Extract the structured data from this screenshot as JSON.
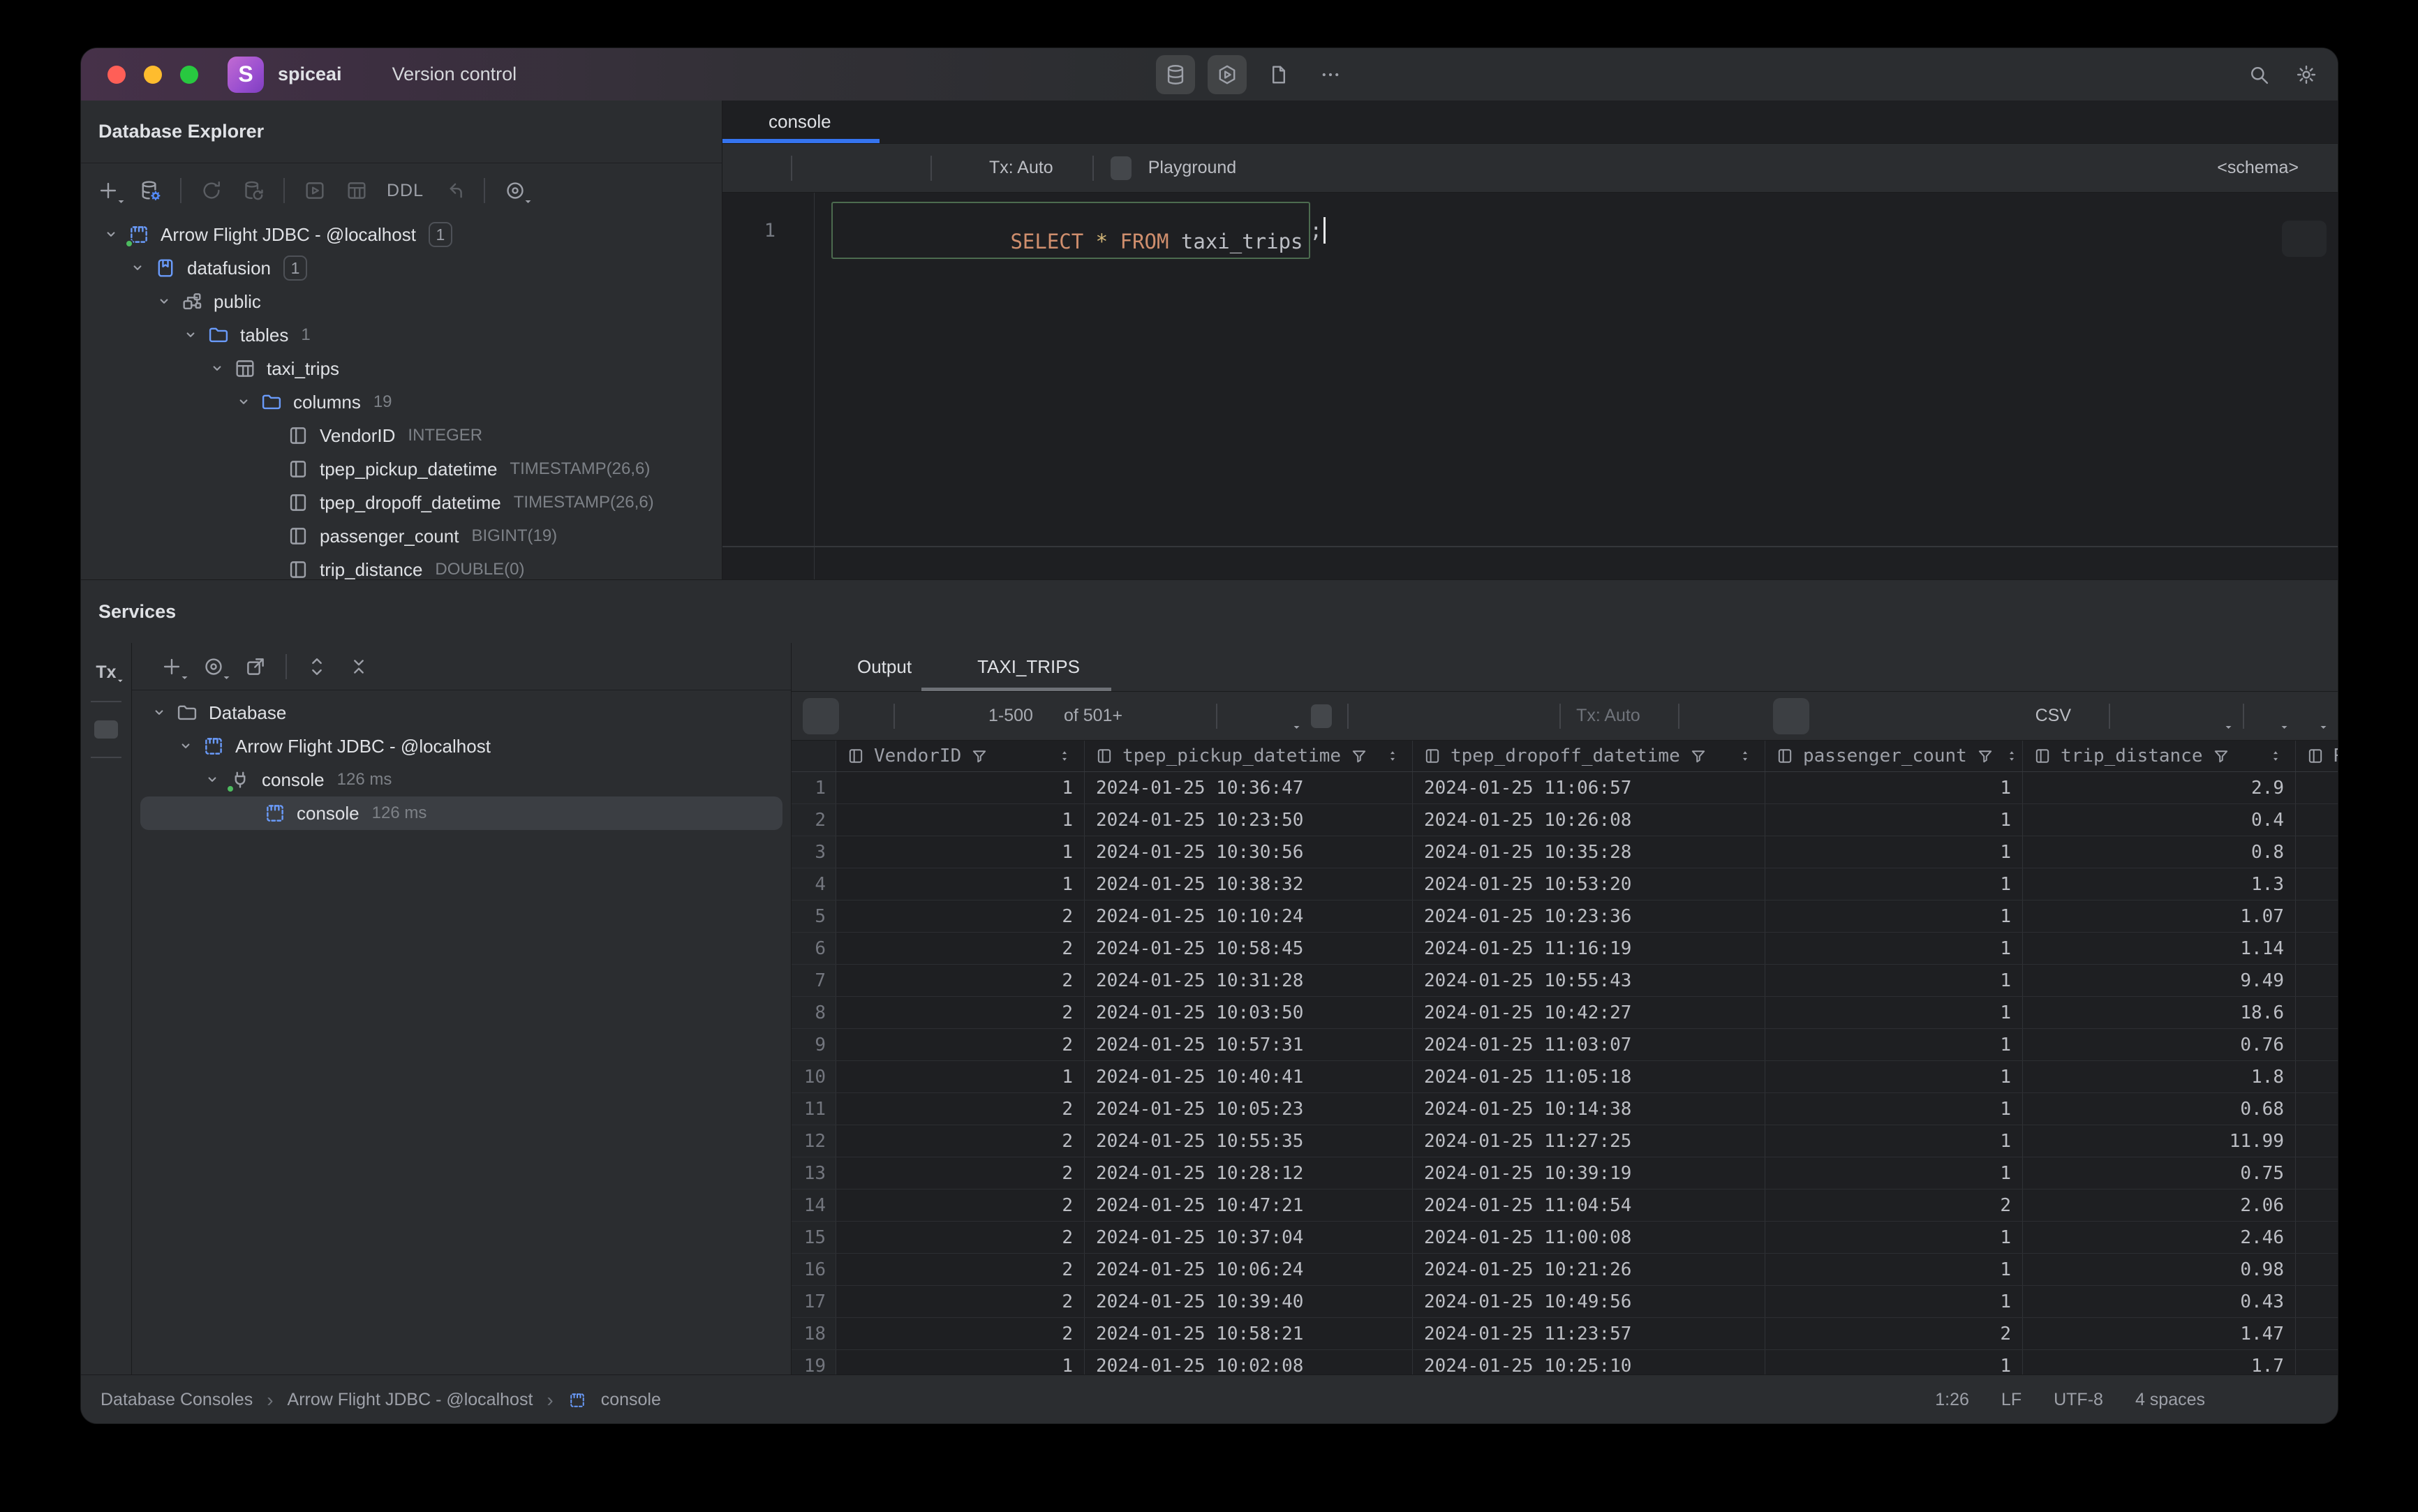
{
  "titlebar": {
    "app_name": "spiceai",
    "menu_version": "Version control",
    "window_buttons": [
      "close",
      "minimize",
      "zoom"
    ],
    "center_icons": [
      {
        "icon": "db",
        "name": "database-tool-icon",
        "active": true
      },
      {
        "icon": "hexplay",
        "name": "run-tool-icon",
        "active": true
      },
      {
        "icon": "file",
        "name": "project-files-icon",
        "active": false
      },
      {
        "icon": "moreh",
        "name": "more-icon",
        "active": false
      }
    ],
    "right_icons": [
      {
        "icon": "search",
        "name": "search-icon"
      },
      {
        "icon": "gear",
        "name": "settings-icon"
      }
    ]
  },
  "database_explorer": {
    "title": "Database Explorer",
    "toolbar": [
      {
        "icon": "plus",
        "name": "add-datasource-icon",
        "dd": true
      },
      {
        "icon": "dbgear",
        "name": "datasource-properties-icon"
      },
      {
        "sep": true
      },
      {
        "icon": "refresh",
        "name": "refresh-icon",
        "disabled": true
      },
      {
        "icon": "dbrefresh",
        "name": "sync-datasource-icon",
        "disabled": true
      },
      {
        "sep": true
      },
      {
        "icon": "playbox",
        "name": "query-console-icon",
        "disabled": true
      },
      {
        "icon": "tablegrid",
        "name": "open-table-icon",
        "disabled": true
      },
      {
        "label": "DDL",
        "name": "ddl-button",
        "disabled": true
      },
      {
        "icon": "jump",
        "name": "navigate-back-icon",
        "disabled": true
      },
      {
        "sep": true
      },
      {
        "icon": "eyetarget",
        "name": "view-options-icon",
        "dd": true
      }
    ],
    "tree": [
      {
        "level": 0,
        "chevron": "down",
        "icon": "dstable",
        "icon_color": "blue",
        "green_dot": true,
        "label": "Arrow Flight JDBC - @localhost",
        "badge": "1"
      },
      {
        "level": 1,
        "chevron": "down",
        "icon": "dbblue",
        "icon_color": "blue",
        "label": "datafusion",
        "badge": "1"
      },
      {
        "level": 2,
        "chevron": "down",
        "icon": "schema",
        "label": "public"
      },
      {
        "level": 3,
        "chevron": "down",
        "icon": "folder",
        "icon_color": "blue",
        "label": "tables",
        "count": "1"
      },
      {
        "level": 4,
        "chevron": "down",
        "icon": "tablegrid",
        "label": "taxi_trips"
      },
      {
        "level": 5,
        "chevron": "down",
        "icon": "folder",
        "icon_color": "blue",
        "label": "columns",
        "count": "19"
      },
      {
        "level": 6,
        "icon": "column",
        "label": "VendorID",
        "type": "INTEGER"
      },
      {
        "level": 6,
        "icon": "column",
        "label": "tpep_pickup_datetime",
        "type": "TIMESTAMP(26,6)"
      },
      {
        "level": 6,
        "icon": "column",
        "label": "tpep_dropoff_datetime",
        "type": "TIMESTAMP(26,6)"
      },
      {
        "level": 6,
        "icon": "column",
        "label": "passenger_count",
        "type": "BIGINT(19)"
      },
      {
        "level": 6,
        "icon": "column",
        "label": "trip_distance",
        "type": "DOUBLE(0)"
      }
    ]
  },
  "editor": {
    "tab_label": "console",
    "toolbar": {
      "tx_label": "Tx: Auto",
      "playground_label": "Playground",
      "schema_label": "<schema>"
    },
    "line_number": "1",
    "code": {
      "keyword1": "SELECT",
      "star": "*",
      "keyword2": "FROM",
      "identifier": "taxi_trips",
      "semicolon": ";"
    }
  },
  "services": {
    "title": "Services",
    "toolbar": [
      {
        "icon": "plus",
        "name": "add-service-icon",
        "dd": true
      },
      {
        "icon": "eyetarget",
        "name": "view-options-icon",
        "dd": true
      },
      {
        "icon": "opennew",
        "name": "open-in-new-icon"
      },
      {
        "sep": true
      },
      {
        "icon": "expand",
        "name": "expand-all-icon"
      },
      {
        "icon": "collapse",
        "name": "collapse-all-icon"
      }
    ],
    "tree": [
      {
        "level": 0,
        "chevron": "down",
        "icon": "folder",
        "label": "Database"
      },
      {
        "level": 1,
        "chevron": "down",
        "icon": "dstable",
        "icon_color": "blue",
        "label": "Arrow Flight JDBC - @localhost"
      },
      {
        "level": 2,
        "chevron": "down",
        "icon": "plug",
        "green_dot": true,
        "label": "console",
        "meta": "126 ms"
      },
      {
        "level": 3,
        "icon": "dstable",
        "icon_color": "blue",
        "label": "console",
        "meta": "126 ms",
        "selected": true
      }
    ]
  },
  "results": {
    "tabs": [
      {
        "label": "Output",
        "icon": "terminal"
      },
      {
        "label": "TAXI_TRIPS",
        "icon": "tablegrid",
        "active": true,
        "closable": true
      }
    ],
    "pager": {
      "range": "1-500",
      "of_label": "of 501+"
    },
    "tx_label": "Tx: Auto",
    "export_format": "CSV",
    "grid": {
      "columns": [
        "VendorID",
        "tpep_pickup_datetime",
        "tpep_dropoff_datetime",
        "passenger_count",
        "trip_distance",
        "Rate"
      ],
      "rows": [
        {
          "n": "1",
          "vendor": "1",
          "pickup": "2024-01-25 10:36:47",
          "dropoff": "2024-01-25 11:06:57",
          "passengers": "1",
          "distance": "2.9"
        },
        {
          "n": "2",
          "vendor": "1",
          "pickup": "2024-01-25 10:23:50",
          "dropoff": "2024-01-25 10:26:08",
          "passengers": "1",
          "distance": "0.4"
        },
        {
          "n": "3",
          "vendor": "1",
          "pickup": "2024-01-25 10:30:56",
          "dropoff": "2024-01-25 10:35:28",
          "passengers": "1",
          "distance": "0.8"
        },
        {
          "n": "4",
          "vendor": "1",
          "pickup": "2024-01-25 10:38:32",
          "dropoff": "2024-01-25 10:53:20",
          "passengers": "1",
          "distance": "1.3"
        },
        {
          "n": "5",
          "vendor": "2",
          "pickup": "2024-01-25 10:10:24",
          "dropoff": "2024-01-25 10:23:36",
          "passengers": "1",
          "distance": "1.07"
        },
        {
          "n": "6",
          "vendor": "2",
          "pickup": "2024-01-25 10:58:45",
          "dropoff": "2024-01-25 11:16:19",
          "passengers": "1",
          "distance": "1.14"
        },
        {
          "n": "7",
          "vendor": "2",
          "pickup": "2024-01-25 10:31:28",
          "dropoff": "2024-01-25 10:55:43",
          "passengers": "1",
          "distance": "9.49"
        },
        {
          "n": "8",
          "vendor": "2",
          "pickup": "2024-01-25 10:03:50",
          "dropoff": "2024-01-25 10:42:27",
          "passengers": "1",
          "distance": "18.6"
        },
        {
          "n": "9",
          "vendor": "2",
          "pickup": "2024-01-25 10:57:31",
          "dropoff": "2024-01-25 11:03:07",
          "passengers": "1",
          "distance": "0.76"
        },
        {
          "n": "10",
          "vendor": "1",
          "pickup": "2024-01-25 10:40:41",
          "dropoff": "2024-01-25 11:05:18",
          "passengers": "1",
          "distance": "1.8"
        },
        {
          "n": "11",
          "vendor": "2",
          "pickup": "2024-01-25 10:05:23",
          "dropoff": "2024-01-25 10:14:38",
          "passengers": "1",
          "distance": "0.68"
        },
        {
          "n": "12",
          "vendor": "2",
          "pickup": "2024-01-25 10:55:35",
          "dropoff": "2024-01-25 11:27:25",
          "passengers": "1",
          "distance": "11.99"
        },
        {
          "n": "13",
          "vendor": "2",
          "pickup": "2024-01-25 10:28:12",
          "dropoff": "2024-01-25 10:39:19",
          "passengers": "1",
          "distance": "0.75"
        },
        {
          "n": "14",
          "vendor": "2",
          "pickup": "2024-01-25 10:47:21",
          "dropoff": "2024-01-25 11:04:54",
          "passengers": "2",
          "distance": "2.06"
        },
        {
          "n": "15",
          "vendor": "2",
          "pickup": "2024-01-25 10:37:04",
          "dropoff": "2024-01-25 11:00:08",
          "passengers": "1",
          "distance": "2.46"
        },
        {
          "n": "16",
          "vendor": "2",
          "pickup": "2024-01-25 10:06:24",
          "dropoff": "2024-01-25 10:21:26",
          "passengers": "1",
          "distance": "0.98"
        },
        {
          "n": "17",
          "vendor": "2",
          "pickup": "2024-01-25 10:39:40",
          "dropoff": "2024-01-25 10:49:56",
          "passengers": "1",
          "distance": "0.43"
        },
        {
          "n": "18",
          "vendor": "2",
          "pickup": "2024-01-25 10:58:21",
          "dropoff": "2024-01-25 11:23:57",
          "passengers": "2",
          "distance": "1.47"
        },
        {
          "n": "19",
          "vendor": "1",
          "pickup": "2024-01-25 10:02:08",
          "dropoff": "2024-01-25 10:25:10",
          "passengers": "1",
          "distance": "1.7"
        }
      ]
    }
  },
  "status_bar": {
    "breadcrumbs": [
      "Database Consoles",
      "Arrow Flight JDBC - @localhost",
      "console"
    ],
    "caret_position": "1:26",
    "line_ending": "LF",
    "encoding": "UTF-8",
    "indent": "4 spaces"
  },
  "colors": {
    "accent_blue": "#3574f0",
    "run_green": "#57965c",
    "keyword_orange": "#cf8e6d",
    "panel_bg": "#2b2d30",
    "editor_bg": "#1e1f22"
  }
}
